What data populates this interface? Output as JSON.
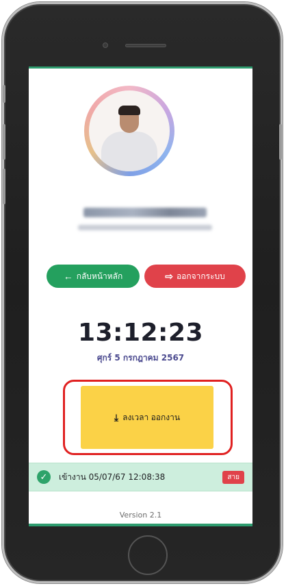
{
  "nav": {
    "home_label": "กลับหน้าหลัก",
    "home_icon": "arrow-left-icon",
    "logout_label": "ออกจากระบบ",
    "logout_icon": "sign-out-icon"
  },
  "clock": {
    "time": "13:12:23",
    "date": "ศุกร์ 5 กรกฎาคม 2567"
  },
  "action": {
    "checkout_label": "ลงเวลา ออกงาน",
    "checkout_icon": "download-icon"
  },
  "status": {
    "text": "เข้างาน 05/07/67 12:08:38",
    "badge": "สาย",
    "icon": "check-circle-icon"
  },
  "footer": {
    "version": "Version 2.1"
  },
  "colors": {
    "accent_green": "#24a05e",
    "logout_red": "#e0424a",
    "checkout_yellow": "#fbd247",
    "highlight_red": "#e02020"
  }
}
